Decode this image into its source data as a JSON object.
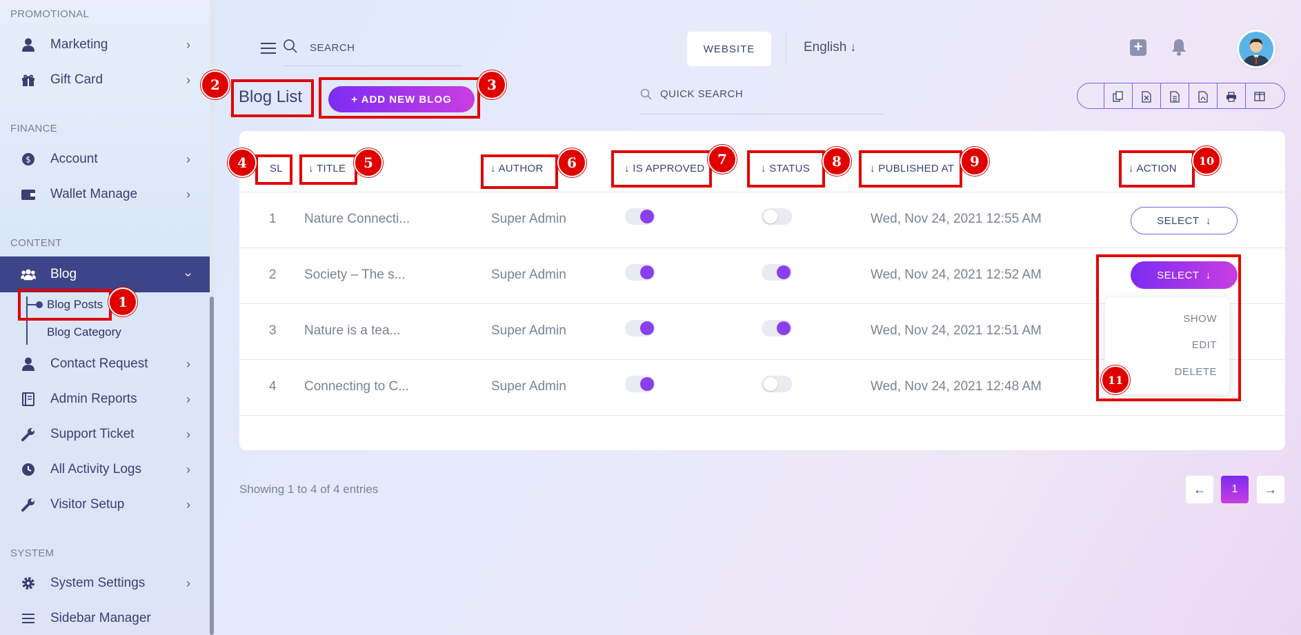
{
  "sidebar": {
    "sections": {
      "promotional": "PROMOTIONAL",
      "finance": "FINANCE",
      "content": "CONTENT",
      "system": "SYSTEM"
    },
    "items": [
      {
        "label": "Marketing",
        "icon": "user-icon"
      },
      {
        "label": "Gift Card",
        "icon": "gift-icon"
      },
      {
        "label": "Account",
        "icon": "money-icon"
      },
      {
        "label": "Wallet Manage",
        "icon": "wallet-icon"
      },
      {
        "label": "Blog",
        "icon": "users-icon",
        "active": true
      },
      {
        "label": "Contact Request",
        "icon": "user-icon"
      },
      {
        "label": "Admin Reports",
        "icon": "report-icon"
      },
      {
        "label": "Support Ticket",
        "icon": "wrench-icon"
      },
      {
        "label": "All Activity Logs",
        "icon": "clock-icon"
      },
      {
        "label": "Visitor Setup",
        "icon": "wrench-icon"
      },
      {
        "label": "System Settings",
        "icon": "gear-icon"
      },
      {
        "label": "Sidebar Manager",
        "icon": "menu-icon"
      }
    ],
    "blog_sub": [
      "Blog Posts",
      "Blog Category"
    ]
  },
  "header": {
    "search_placeholder": "SEARCH",
    "website_label": "WEBSITE",
    "language": "English"
  },
  "page": {
    "title": "Blog List",
    "add_button": "+ ADD NEW BLOG",
    "quick_search": "QUICK SEARCH"
  },
  "table": {
    "columns": [
      "SL",
      "TITLE",
      "AUTHOR",
      "IS APPROVED",
      "STATUS",
      "PUBLISHED AT",
      "ACTION"
    ],
    "rows": [
      {
        "sl": "1",
        "title": "Nature Connecti...",
        "author": "Super Admin",
        "approved": true,
        "status": false,
        "published": "Wed, Nov 24, 2021 12:55 AM"
      },
      {
        "sl": "2",
        "title": "Society – The s...",
        "author": "Super Admin",
        "approved": true,
        "status": true,
        "published": "Wed, Nov 24, 2021 12:52 AM"
      },
      {
        "sl": "3",
        "title": "Nature is a tea...",
        "author": "Super Admin",
        "approved": true,
        "status": true,
        "published": "Wed, Nov 24, 2021 12:51 AM"
      },
      {
        "sl": "4",
        "title": "Connecting to C...",
        "author": "Super Admin",
        "approved": true,
        "status": false,
        "published": "Wed, Nov 24, 2021 12:48 AM"
      }
    ],
    "select_label": "SELECT",
    "dropdown": [
      "SHOW",
      "EDIT",
      "DELETE"
    ]
  },
  "footer": {
    "showing": "Showing 1 to 4 of 4 entries",
    "current_page": "1"
  },
  "annotations": [
    "1",
    "2",
    "3",
    "4",
    "5",
    "6",
    "7",
    "8",
    "9",
    "10",
    "11"
  ],
  "colors": {
    "accent": "#7c2cf2",
    "accent_end": "#c83ee0",
    "sidebar_active": "#3d4488",
    "highlight": "#e00000"
  }
}
